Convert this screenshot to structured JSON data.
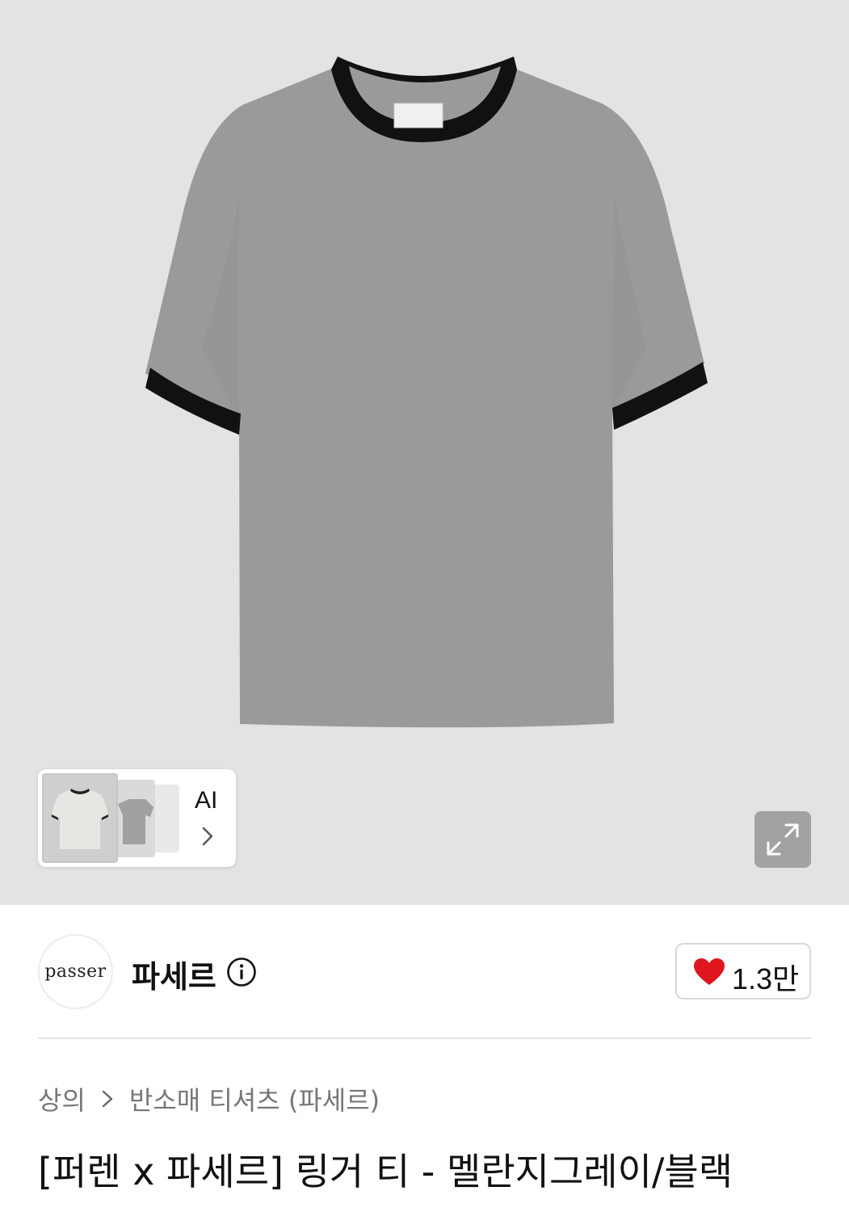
{
  "gallery": {
    "ai_badge_label": "AI",
    "background_color": "#e3e3e3"
  },
  "brand": {
    "logo_text": "passer",
    "name": "파세르"
  },
  "like": {
    "count": "1.3만",
    "heart_color": "#e0161f"
  },
  "breadcrumb": {
    "items": [
      "상의",
      "반소매 티셔츠 (파세르)"
    ]
  },
  "product": {
    "title": "[퍼렌 x 파세르] 링거 티 - 멜란지그레이/블랙"
  },
  "icons": [
    "chevron-right-icon",
    "expand-icon",
    "info-icon",
    "heart-icon"
  ]
}
